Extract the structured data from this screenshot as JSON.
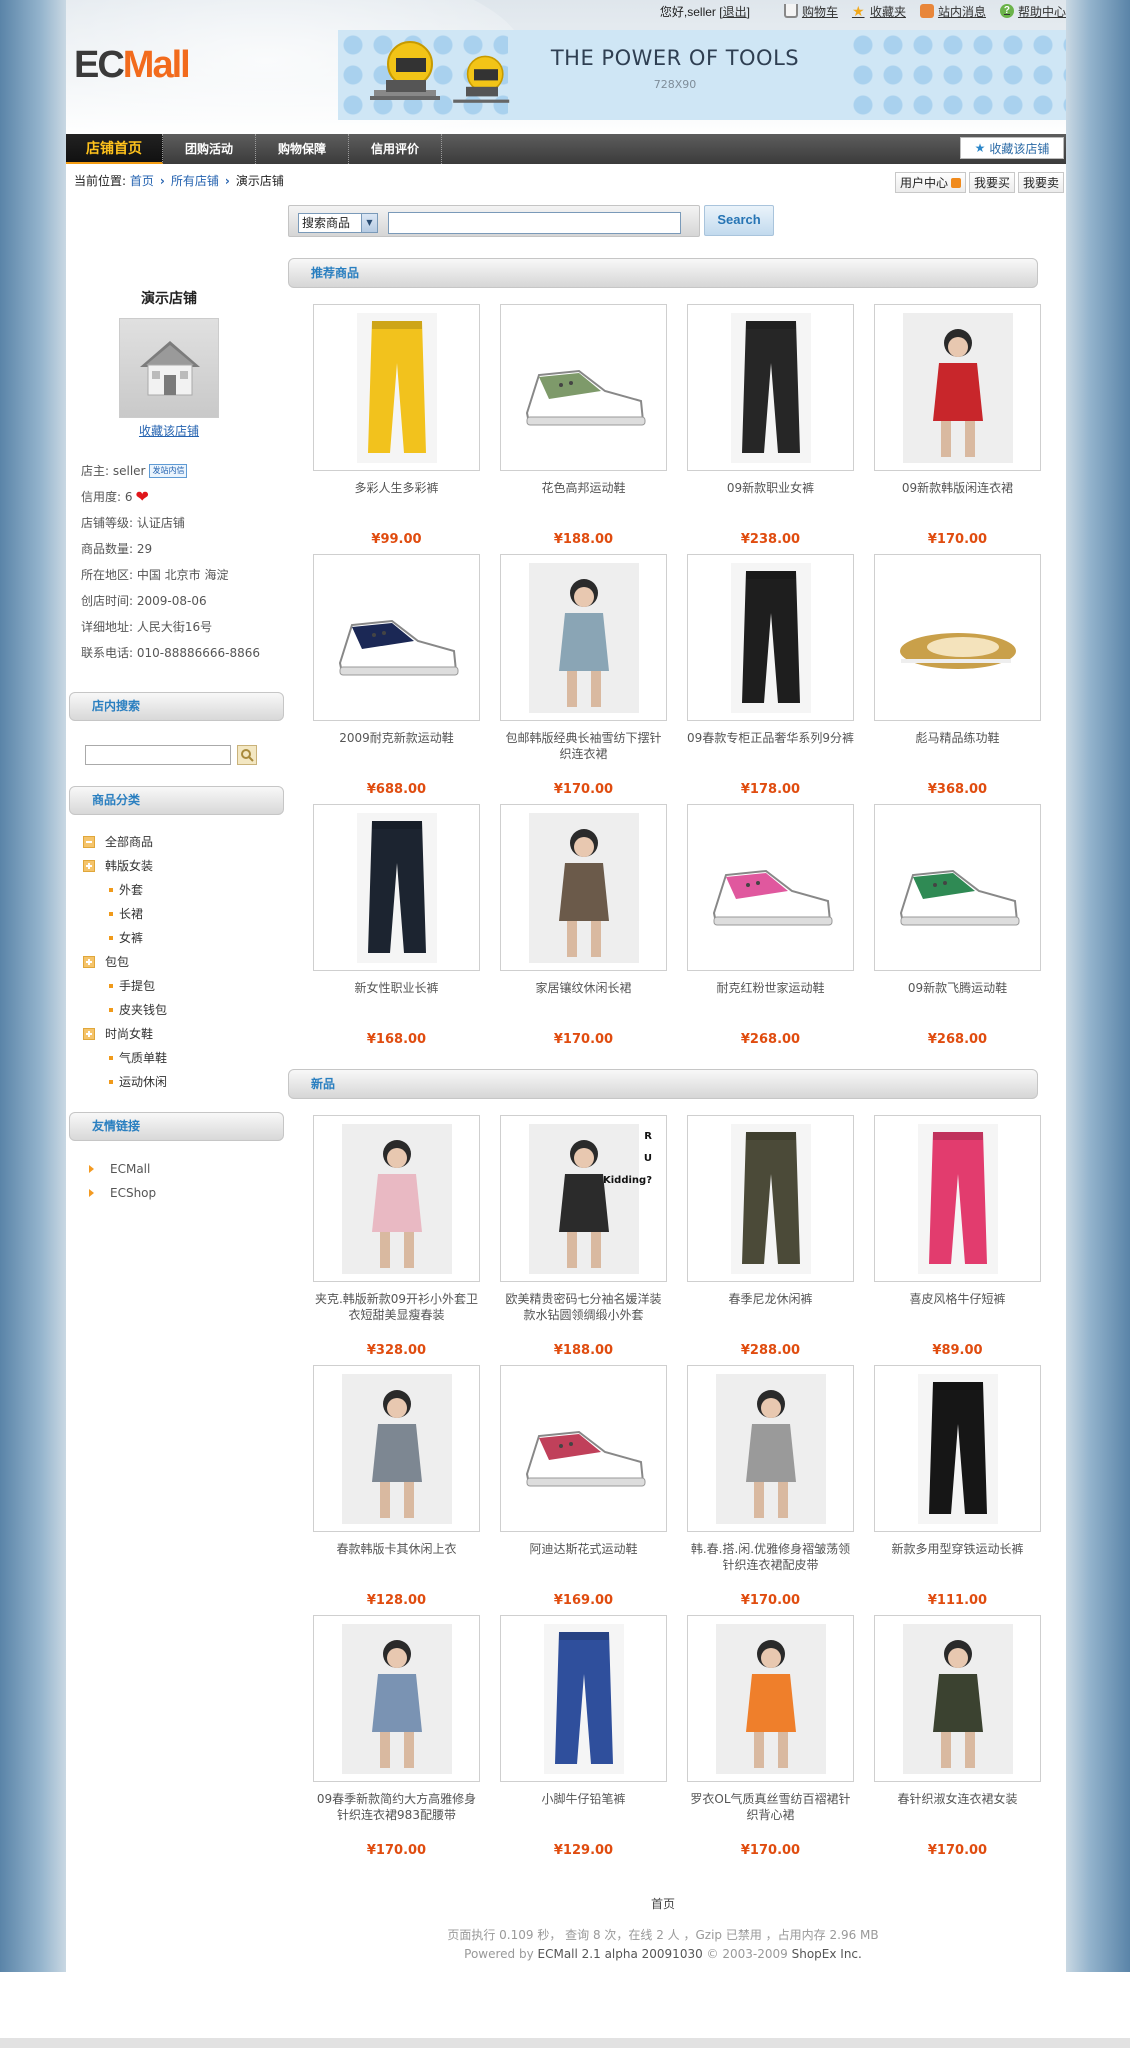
{
  "colors": {
    "accent": "#2a7fc0",
    "price": "#e04c0f",
    "nav_active": "#ffc21c",
    "brand_orange": "#f26b1d"
  },
  "header": {
    "logo_ec": "EC",
    "logo_mall": "Mall",
    "greeting": "您好,seller",
    "logout": "退出",
    "top_links": [
      {
        "label": "购物车",
        "icon": "cart-icon"
      },
      {
        "label": "收藏夹",
        "icon": "star-icon"
      },
      {
        "label": "站内消息",
        "icon": "message-icon"
      },
      {
        "label": "帮助中心",
        "icon": "help-icon"
      }
    ],
    "banner_title": "THE POWER OF TOOLS",
    "banner_size": "728X90"
  },
  "nav": {
    "items": [
      "店铺首页",
      "团购活动",
      "购物保障",
      "信用评价"
    ],
    "active_index": 0,
    "fav_store": "收藏该店铺"
  },
  "breadcrumb": {
    "label": "当前位置:",
    "items": [
      "首页",
      "所有店铺",
      "演示店铺"
    ]
  },
  "user_links": [
    "用户中心",
    "我要买",
    "我要卖"
  ],
  "search": {
    "select_value": "搜索商品",
    "input_value": "",
    "button": "Search"
  },
  "store": {
    "name": "演示店铺",
    "fav_link": "收藏该店铺",
    "owner_label": "店主: seller",
    "cert_badge": "发站内信",
    "credit_label": "信用度: 6",
    "level": "店铺等级: 认证店铺",
    "goods_count": "商品数量: 29",
    "region": "所在地区: 中国  北京市  海淀",
    "created": "创店时间: 2009-08-06",
    "address": "详细地址: 人民大街16号",
    "phone": "联系电话: 010-88886666-8866"
  },
  "sidebar": {
    "search_title": "店内搜索",
    "category_title": "商品分类",
    "categories": [
      {
        "label": "全部商品",
        "level": 0,
        "icon": "minus"
      },
      {
        "label": "韩版女装",
        "level": 0,
        "icon": "plus"
      },
      {
        "label": "外套",
        "level": 1
      },
      {
        "label": "长裙",
        "level": 1
      },
      {
        "label": "女裤",
        "level": 1
      },
      {
        "label": "包包",
        "level": 0,
        "icon": "plus"
      },
      {
        "label": "手提包",
        "level": 1
      },
      {
        "label": "皮夹钱包",
        "level": 1
      },
      {
        "label": "时尚女鞋",
        "level": 0,
        "icon": "plus"
      },
      {
        "label": "气质单鞋",
        "level": 1
      },
      {
        "label": "运动休闲",
        "level": 1
      }
    ],
    "links_title": "友情链接",
    "links": [
      "ECMall",
      "ECShop"
    ]
  },
  "recommended": {
    "title": "推荐商品",
    "products": [
      {
        "name": "多彩人生多彩裤",
        "price": "¥99.00",
        "kind": "pants",
        "color": "#f2c21d"
      },
      {
        "name": "花色高邦运动鞋",
        "price": "¥188.00",
        "kind": "sneaker",
        "color": "#7e9a6a"
      },
      {
        "name": "09新款职业女裤",
        "price": "¥238.00",
        "kind": "pants",
        "color": "#262626"
      },
      {
        "name": "09新款韩版闲连衣裙",
        "price": "¥170.00",
        "kind": "person",
        "color": "#c8262b"
      },
      {
        "name": "2009耐克新款运动鞋",
        "price": "¥688.00",
        "kind": "sneaker",
        "color": "#1b2855"
      },
      {
        "name": "包邮韩版经典长袖雪纺下摆针织连衣裙",
        "price": "¥170.00",
        "kind": "person",
        "color": "#8aa5b5"
      },
      {
        "name": "09春款专柜正品奢华系列9分裤",
        "price": "¥178.00",
        "kind": "pants",
        "color": "#1e1e1e"
      },
      {
        "name": "彪马精品练功鞋",
        "price": "¥368.00",
        "kind": "flat",
        "color": "#c9a04a"
      },
      {
        "name": "新女性职业长裤",
        "price": "¥168.00",
        "kind": "pants",
        "color": "#1c2430"
      },
      {
        "name": "家居镶纹休闲长裙",
        "price": "¥170.00",
        "kind": "person",
        "color": "#6b5a4a"
      },
      {
        "name": "耐克红粉世家运动鞋",
        "price": "¥268.00",
        "kind": "sneaker",
        "color": "#e0589e"
      },
      {
        "name": "09新款飞腾运动鞋",
        "price": "¥268.00",
        "kind": "sneaker",
        "color": "#2f8a54"
      }
    ]
  },
  "new_items": {
    "title": "新品",
    "products": [
      {
        "name": "夹克.韩版新款09开衫小外套卫衣短甜美显瘦春装",
        "price": "¥328.00",
        "kind": "person",
        "color": "#e9b9c3"
      },
      {
        "name": "欧美精贵密码七分袖名媛洋装款水钻圆领绸缎小外套",
        "price": "¥188.00",
        "kind": "person",
        "color": "#2b2b2b",
        "overlay": "R\nU\nKidding?"
      },
      {
        "name": "春季尼龙休闲裤",
        "price": "¥288.00",
        "kind": "pants",
        "color": "#4b4a38"
      },
      {
        "name": "喜皮风格牛仔短裤",
        "price": "¥89.00",
        "kind": "pants",
        "color": "#e23c6e"
      },
      {
        "name": "春款韩版卡其休闲上衣",
        "price": "¥128.00",
        "kind": "person",
        "color": "#7d8792"
      },
      {
        "name": "阿迪达斯花式运动鞋",
        "price": "¥169.00",
        "kind": "sneaker",
        "color": "#c0405a"
      },
      {
        "name": "韩.春.搭.闲.优雅修身褶皱荡领针织连衣裙配皮带",
        "price": "¥170.00",
        "kind": "person",
        "color": "#9a9a9a"
      },
      {
        "name": "新款多用型穿铁运动长裤",
        "price": "¥111.00",
        "kind": "pants",
        "color": "#161616"
      },
      {
        "name": "09春季新款简约大方高雅修身针织连衣裙983配腰带",
        "price": "¥170.00",
        "kind": "person",
        "color": "#7a93b3"
      },
      {
        "name": "小脚牛仔铅笔裤",
        "price": "¥129.00",
        "kind": "pants",
        "color": "#2f4f9c"
      },
      {
        "name": "罗衣OL气质真丝雪纺百褶裙针织背心裙",
        "price": "¥170.00",
        "kind": "person",
        "color": "#ef7f2b"
      },
      {
        "name": "春针织淑女连衣裙女装",
        "price": "¥170.00",
        "kind": "person",
        "color": "#3b4230"
      }
    ]
  },
  "pager": {
    "label": "首页"
  },
  "footer": {
    "line1": "页面执行 0.109 秒， 查询 8 次，在线 2 人 ，Gzip 已禁用 ，占用内存 2.96 MB",
    "powered_prefix": "Powered by ",
    "powered_product": "ECMall 2.1 alpha 20091030",
    "powered_suffix": " © 2003-2009 ",
    "company": "ShopEx Inc."
  }
}
